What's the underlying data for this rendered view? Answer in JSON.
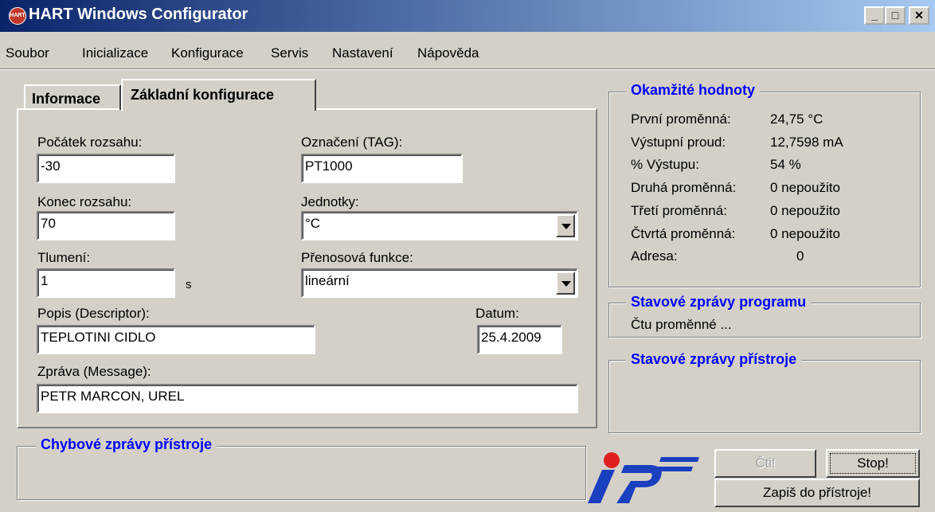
{
  "window": {
    "title": "HART Windows Configurator",
    "app_icon_text": "HART"
  },
  "caption_buttons": {
    "minimize": "_",
    "maximize": "□",
    "close": "✕"
  },
  "menu": [
    "Soubor",
    "Inicializace",
    "Konfigurace",
    "Servis",
    "Nastavení",
    "Nápověda"
  ],
  "tabs": {
    "info": "Informace",
    "basic": "Základní konfigurace"
  },
  "form": {
    "range_start_label": "Počátek rozsahu:",
    "range_start_value": "-30",
    "range_end_label": "Konec rozsahu:",
    "range_end_value": "70",
    "damping_label": "Tlumení:",
    "damping_value": "1",
    "damping_unit": "s",
    "tag_label": "Označení (TAG):",
    "tag_value": "PT1000",
    "units_label": "Jednotky:",
    "units_value": "°C",
    "transfer_label": "Přenosová funkce:",
    "transfer_value": "lineární",
    "descriptor_label": "Popis (Descriptor):",
    "descriptor_value": "TEPLOTINI CIDLO",
    "date_label": "Datum:",
    "date_value": "25.4.2009",
    "message_label": "Zpráva (Message):",
    "message_value": "PETR MARCON, UREL"
  },
  "instant_values": {
    "title": "Okamžité hodnoty",
    "rows": [
      {
        "label": "První proměnná:",
        "value": "24,75 °C"
      },
      {
        "label": "Výstupní proud:",
        "value": "12,7598 mA"
      },
      {
        "label": "% Výstupu:",
        "value": "54 %"
      },
      {
        "label": "Druhá proměnná:",
        "value": "0 nepoužito"
      },
      {
        "label": "Třetí proměnná:",
        "value": "0 nepoužito"
      },
      {
        "label": "Čtvrtá proměnná:",
        "value": "0 nepoužito"
      },
      {
        "label": "Adresa:",
        "value": "0"
      }
    ]
  },
  "program_status": {
    "title": "Stavové zprávy programu",
    "text": "Čtu proměnné ..."
  },
  "device_status": {
    "title": "Stavové zprávy přístroje"
  },
  "device_errors": {
    "title": "Chybové zprávy přístroje"
  },
  "buttons": {
    "read": "Čti!",
    "stop": "Stop!",
    "write": "Zapiš do přístroje!"
  },
  "colors": {
    "titlebar_start": "#0a246a",
    "titlebar_end": "#a6caf0",
    "group_title": "#0000ff",
    "logo_blue": "#1a3fbf",
    "logo_dot": "#e02020"
  }
}
